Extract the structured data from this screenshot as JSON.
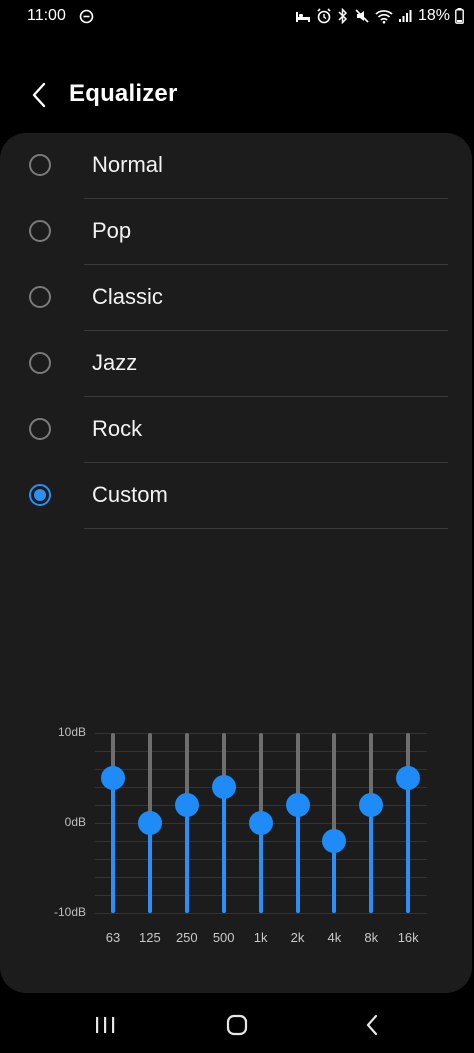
{
  "status_bar": {
    "time": "11:00",
    "battery": "18%",
    "icons": [
      "do-not-disturb-icon",
      "bed-icon",
      "alarm-icon",
      "bluetooth-icon",
      "mute-icon",
      "wifi-icon",
      "signal-icon",
      "battery-icon"
    ]
  },
  "header": {
    "title": "Equalizer",
    "back_icon": "chevron-left-icon"
  },
  "presets": {
    "options": [
      {
        "label": "Normal",
        "selected": false
      },
      {
        "label": "Pop",
        "selected": false
      },
      {
        "label": "Classic",
        "selected": false
      },
      {
        "label": "Jazz",
        "selected": false
      },
      {
        "label": "Rock",
        "selected": false
      },
      {
        "label": "Custom",
        "selected": true
      }
    ]
  },
  "equalizer": {
    "db_labels": {
      "top": "10dB",
      "middle": "0dB",
      "bottom": "-10dB"
    },
    "range": [
      -10,
      10
    ],
    "bands": [
      {
        "freq": "63",
        "value": 5
      },
      {
        "freq": "125",
        "value": 0
      },
      {
        "freq": "250",
        "value": 2
      },
      {
        "freq": "500",
        "value": 4
      },
      {
        "freq": "1k",
        "value": 0
      },
      {
        "freq": "2k",
        "value": 2
      },
      {
        "freq": "4k",
        "value": -2
      },
      {
        "freq": "8k",
        "value": 2
      },
      {
        "freq": "16k",
        "value": 5
      }
    ]
  },
  "colors": {
    "accent": "#1f8bf7",
    "card_background": "#1c1c1c",
    "page_background": "#000000",
    "track": "#6e6e6e"
  },
  "nav_bar": {
    "items": [
      "recent-apps-icon",
      "home-icon",
      "back-icon"
    ]
  }
}
